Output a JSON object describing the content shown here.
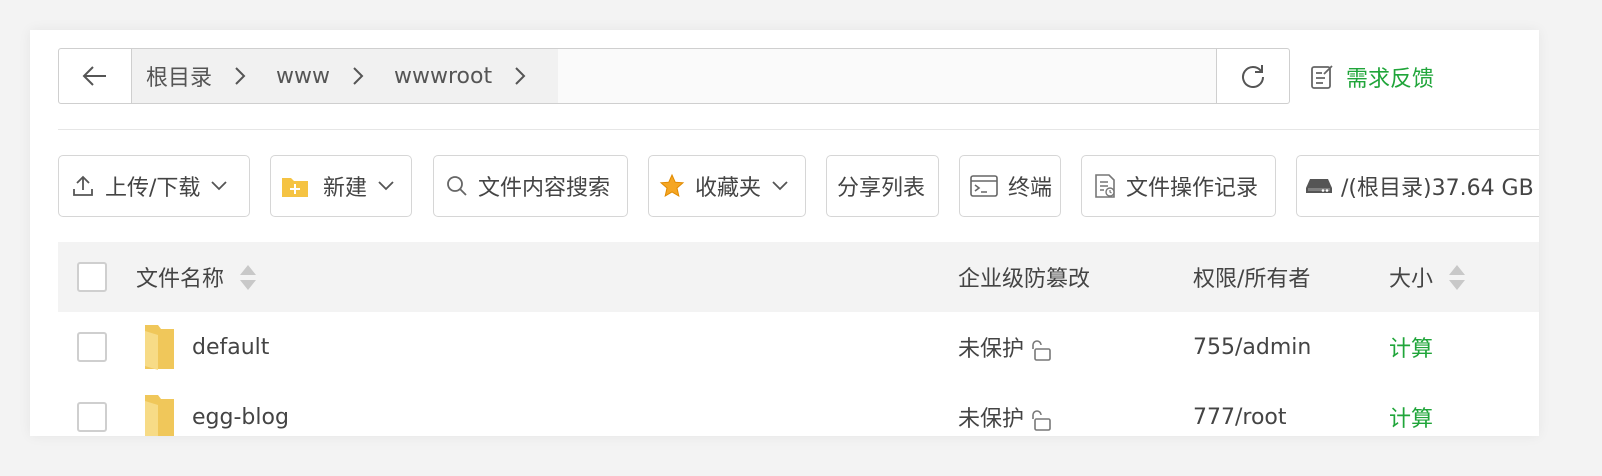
{
  "address_bar": {
    "breadcrumbs": [
      "根目录",
      "www",
      "wwwroot"
    ]
  },
  "feedback": {
    "label": "需求反馈"
  },
  "toolbar": {
    "upload_download": "上传/下载",
    "new": "新建",
    "content_search": "文件内容搜索",
    "favorites": "收藏夹",
    "share_list": "分享列表",
    "terminal": "终端",
    "operation_log": "文件操作记录",
    "disk": "/(根目录)37.64 GB"
  },
  "table": {
    "headers": {
      "name": "文件名称",
      "tamper": "企业级防篡改",
      "perm": "权限/所有者",
      "size": "大小"
    },
    "rows": [
      {
        "name": "default",
        "tamper": "未保护",
        "perm": "755/admin",
        "size": "计算"
      },
      {
        "name": "egg-blog",
        "tamper": "未保护",
        "perm": "777/root",
        "size": "计算"
      }
    ]
  },
  "colors": {
    "accent": "#20a53a",
    "folder": "#f5d36b"
  }
}
